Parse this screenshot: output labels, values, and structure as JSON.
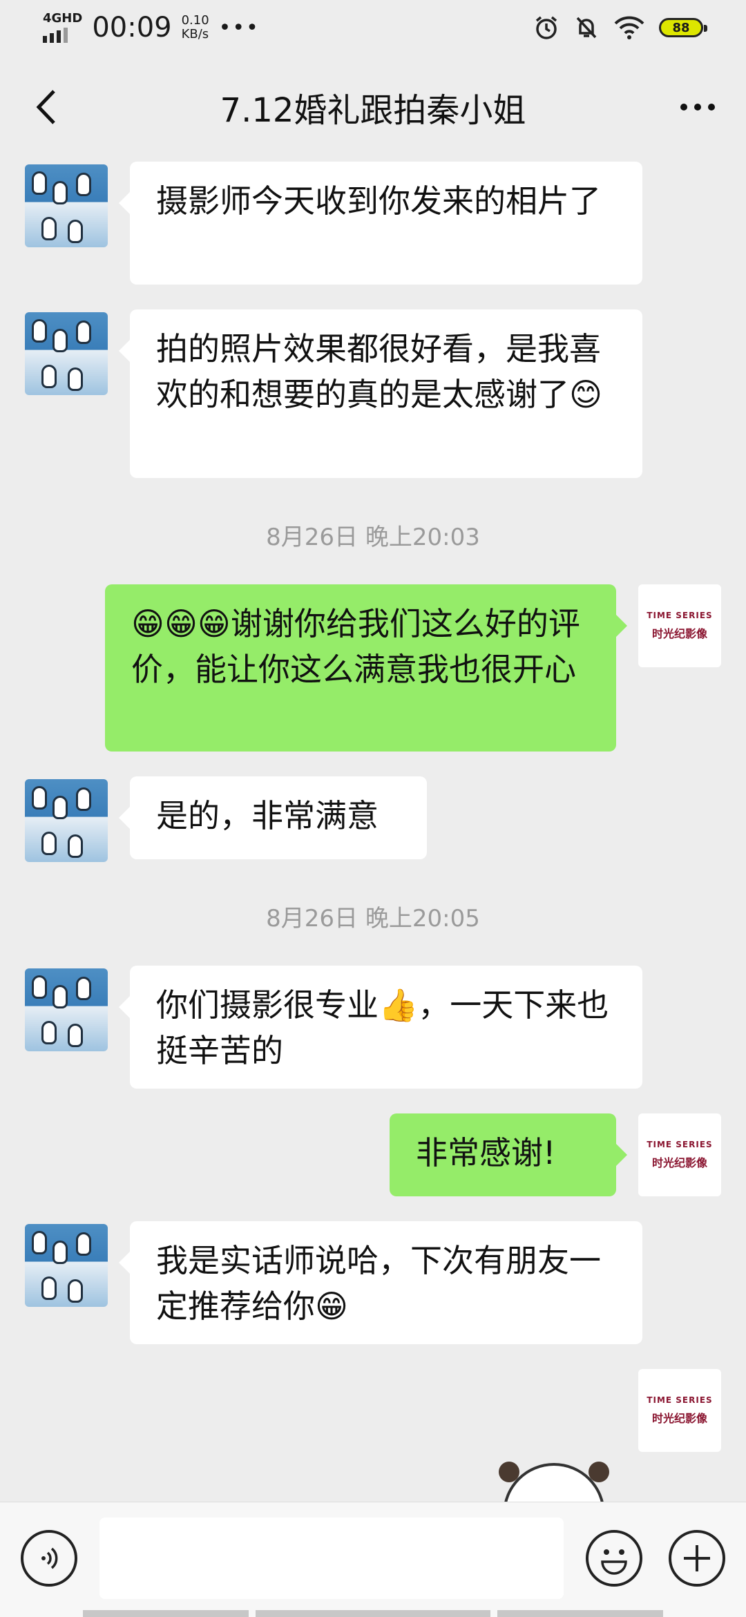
{
  "status_bar": {
    "network": "4GHD",
    "time": "00:09",
    "speed_value": "0.10",
    "speed_unit": "KB/s",
    "more": "•••",
    "battery": "88"
  },
  "header": {
    "title": "7.12婚礼跟拍秦小姐"
  },
  "messages": [
    {
      "side": "left",
      "text": "摄影师今天收到你发来的相片了"
    },
    {
      "side": "left",
      "text": "拍的照片效果都很好看，是我喜欢的和想要的真的是太感谢了😊"
    },
    {
      "side": "time",
      "text": "8月26日 晚上20:03"
    },
    {
      "side": "right",
      "text": "😁😁😁谢谢你给我们这么好的评价，能让你这么满意我也很开心"
    },
    {
      "side": "left",
      "text": "是的，非常满意"
    },
    {
      "side": "time",
      "text": "8月26日 晚上20:05"
    },
    {
      "side": "left",
      "text": "你们摄影很专业👍，一天下来也挺辛苦的"
    },
    {
      "side": "right",
      "text": "非常感谢!"
    },
    {
      "side": "left",
      "text": "我是实话师说哈，下次有朋友一定推荐给你😁"
    }
  ],
  "my_avatar": {
    "line1": "TIME SERIES",
    "line2": "时光纪影像"
  },
  "input": {
    "value": "",
    "placeholder": ""
  }
}
